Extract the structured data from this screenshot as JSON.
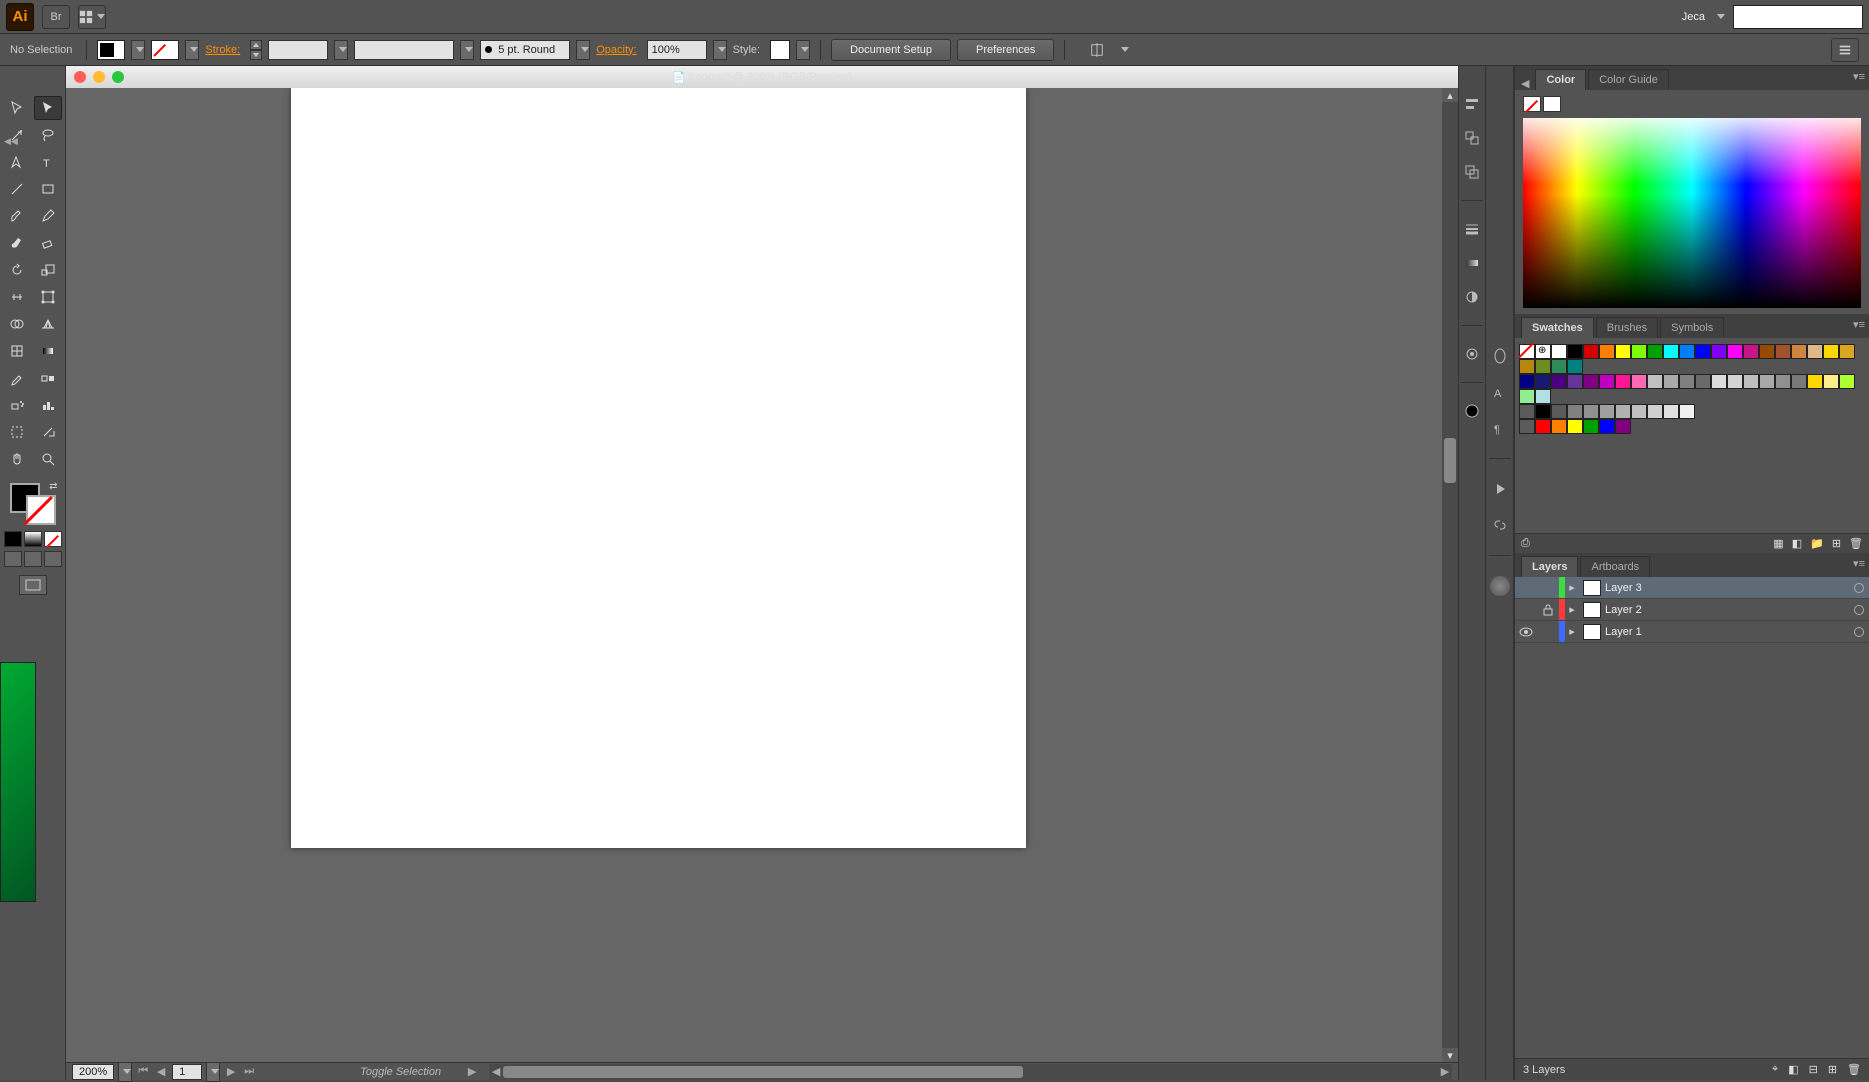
{
  "topbar": {
    "app_abbrev": "Ai",
    "user": "Jeca"
  },
  "controlbar": {
    "selection": "No Selection",
    "stroke_label": "Stroke:",
    "stroke_profile": "5 pt. Round",
    "opacity_label": "Opacity:",
    "opacity_value": "100%",
    "style_label": "Style:",
    "doc_setup": "Document Setup",
    "prefs": "Preferences"
  },
  "window": {
    "title": "Logo.ai* @ 200% (RGB/Preview)"
  },
  "statusbar": {
    "zoom": "200%",
    "artboard_num": "1",
    "message": "Toggle Selection"
  },
  "panel_color": {
    "tab_color": "Color",
    "tab_guide": "Color Guide"
  },
  "panel_swatches": {
    "tab_swatches": "Swatches",
    "tab_brushes": "Brushes",
    "tab_symbols": "Symbols",
    "row1": [
      "#ffffff",
      "#000000",
      "#d40000",
      "#ff7f00",
      "#ffff00",
      "#7fff00",
      "#00a000",
      "#00ffff",
      "#0080ff",
      "#0000ff",
      "#7f00ff",
      "#ff00ff",
      "#c71585",
      "#964b00",
      "#a0522d",
      "#cd853f",
      "#deb887",
      "#ffd700",
      "#daa520",
      "#b8860b",
      "#6b8e23",
      "#2e8b57",
      "#008080"
    ],
    "row2": [
      "#000080",
      "#191970",
      "#4b0082",
      "#663399",
      "#800080",
      "#c000c0",
      "#ff1493",
      "#ff69b4",
      "#c0c0c0",
      "#a9a9a9",
      "#808080",
      "#696969",
      "#dcdcdc",
      "#d3d3d3",
      "#bebebe",
      "#a8a8a8",
      "#909090",
      "#787878",
      "#ffd700",
      "#ffec8b",
      "#adff2f",
      "#90ee90",
      "#b0e0e6"
    ],
    "row3_folders": [
      "#5a5a5a",
      "#000000",
      "#5a5a5a",
      "#808080",
      "#909090",
      "#a0a0a0",
      "#b0b0b0",
      "#c0c0c0",
      "#d0d0d0",
      "#e0e0e0",
      "#f0f0f0"
    ],
    "row4": [
      "#5a5a5a",
      "#ff0000",
      "#ff8000",
      "#ffff00",
      "#00a000",
      "#0000ff",
      "#800080"
    ]
  },
  "panel_layers": {
    "tab_layers": "Layers",
    "tab_artboards": "Artboards",
    "layers": [
      {
        "name": "Layer 3",
        "color": "#3bdf3b",
        "locked": false,
        "visible": false
      },
      {
        "name": "Layer 2",
        "color": "#ff3b3b",
        "locked": true,
        "visible": false
      },
      {
        "name": "Layer 1",
        "color": "#3b6bff",
        "locked": false,
        "visible": true
      }
    ],
    "count_label": "3 Layers"
  }
}
